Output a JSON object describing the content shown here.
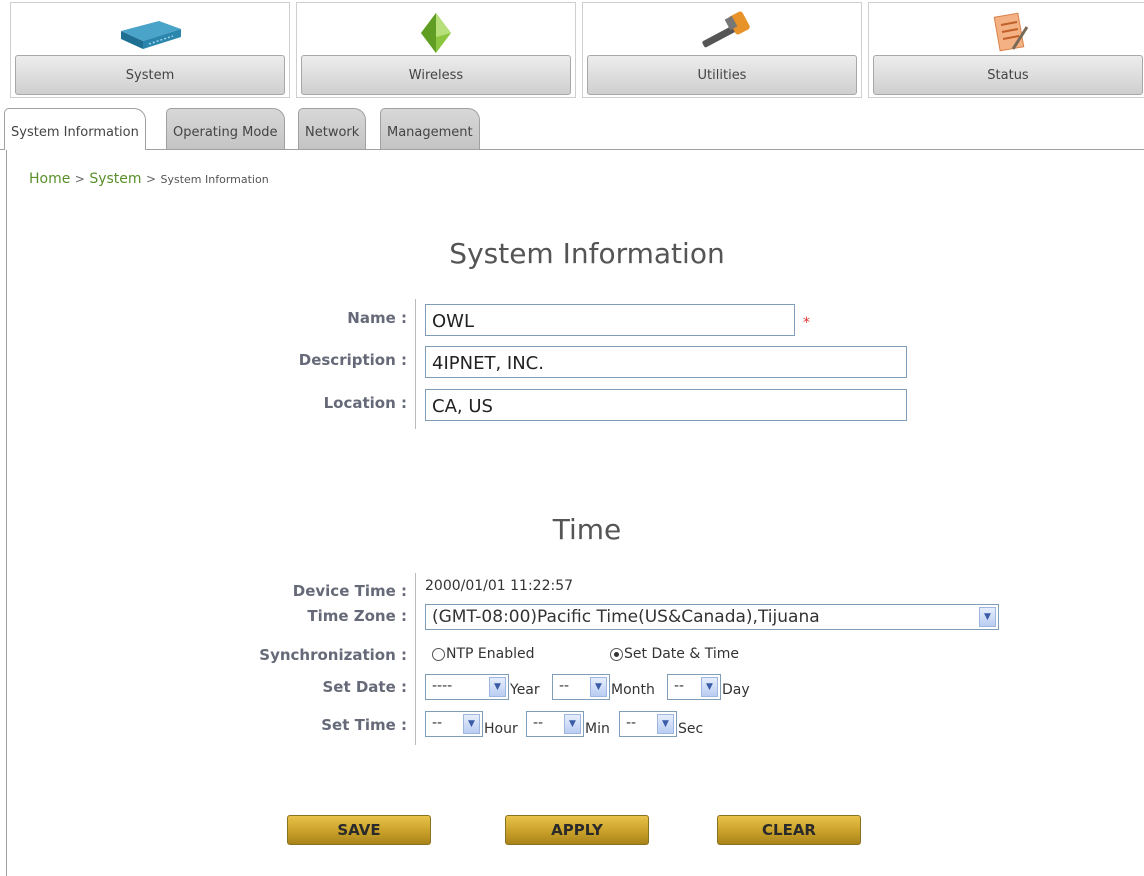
{
  "nav": {
    "items": [
      {
        "label": "System",
        "icon": "router-icon"
      },
      {
        "label": "Wireless",
        "icon": "wireless-icon"
      },
      {
        "label": "Utilities",
        "icon": "hammer-icon"
      },
      {
        "label": "Status",
        "icon": "notepad-icon"
      }
    ]
  },
  "tabs": [
    "System Information",
    "Operating Mode",
    "Network",
    "Management"
  ],
  "breadcrumb": {
    "home": "Home",
    "sep": ">",
    "system": "System",
    "current": "System Information"
  },
  "system_info": {
    "title": "System Information",
    "name_label": "Name :",
    "name_value": "OWL",
    "required_mark": "*",
    "description_label": "Description :",
    "description_value": "4IPNET, INC.",
    "location_label": "Location :",
    "location_value": "CA, US"
  },
  "time": {
    "title": "Time",
    "device_time_label": "Device Time :",
    "device_time_value": "2000/01/01 11:22:57",
    "time_zone_label": "Time Zone :",
    "time_zone_value": "(GMT-08:00)Pacific Time(US&Canada),Tijuana",
    "sync_label": "Synchronization :",
    "ntp_option": "NTP Enabled",
    "manual_option": "Set Date & Time",
    "set_date_label": "Set Date :",
    "year_value": "----",
    "year_unit": "Year",
    "month_value": "--",
    "month_unit": "Month",
    "day_value": "--",
    "day_unit": "Day",
    "set_time_label": "Set Time :",
    "hour_value": "--",
    "hour_unit": "Hour",
    "min_value": "--",
    "min_unit": "Min",
    "sec_value": "--",
    "sec_unit": "Sec"
  },
  "buttons": {
    "save": "SAVE",
    "apply": "APPLY",
    "clear": "CLEAR"
  }
}
